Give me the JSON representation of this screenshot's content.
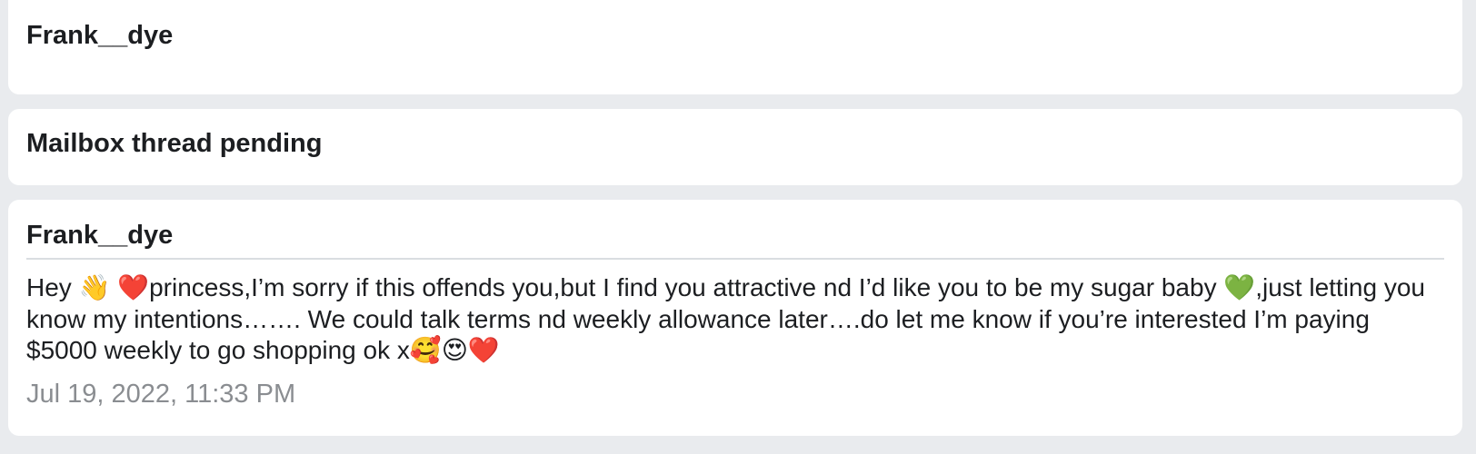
{
  "threads": [
    {
      "sender": "Frank__dye"
    },
    {
      "status": "Mailbox thread pending"
    }
  ],
  "message": {
    "sender": "Frank__dye",
    "body": "Hey 👋 ❤️princess,I’m sorry if this offends you,but I find you attractive nd I’d like you to be my sugar baby 💚,just letting you know my intentions……. We could talk terms nd weekly allowance later….do let me know if you’re interested I’m paying $5000 weekly to go shopping ok x🥰😍❤️",
    "timestamp": "Jul 19, 2022, 11:33 PM"
  }
}
